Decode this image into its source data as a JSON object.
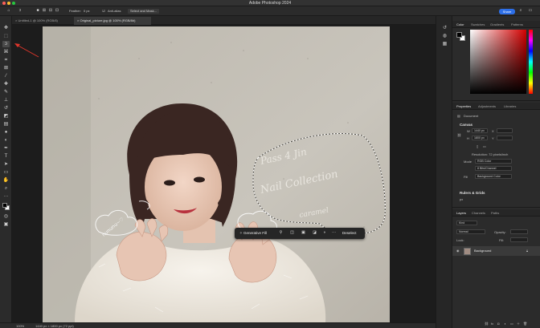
{
  "app": {
    "title": "Adobe Photoshop 2024"
  },
  "options_bar": {
    "feather_label": "Feather:",
    "feather_value": "0 px",
    "anti_alias_label": "Anti-alias",
    "select_mask_label": "Select and Mask...",
    "share_label": "Share"
  },
  "tabs": [
    {
      "label": "Untitled-1 @ 100% (RGB/8)",
      "close": "×"
    },
    {
      "label": "Original_picture.jpg @ 100% (RGB/8#)",
      "close": "×"
    }
  ],
  "taskbar": {
    "generative_fill_label": "Generative Fill",
    "deselect_label": "Deselect",
    "more_label": "···"
  },
  "photo": {
    "wall_text": [
      "Pass 4 Jin",
      "Nail Collection",
      "caramel"
    ],
    "bubble_text": "nununu~♡"
  },
  "status": {
    "zoom": "100%",
    "dimensions": "1440 px × 1800 px (72 ppi)"
  },
  "color_panel": {
    "tabs": [
      "Color",
      "Swatches",
      "Gradients",
      "Patterns"
    ],
    "foreground": "#000000",
    "background": "#ffffff",
    "hue_color": "#d40000"
  },
  "properties_panel": {
    "tabs": [
      "Properties",
      "Adjustments",
      "Libraries"
    ],
    "doc_label": "Document",
    "canvas_heading": "Canvas",
    "w_label": "W",
    "w_value": "1440 px",
    "h_label": "H",
    "h_value": "1800 px",
    "x_label": "X",
    "y_label": "Y",
    "resolution_label": "Resolution: 72 pixels/inch",
    "mode_label": "Mode",
    "mode_value": "RGB Color",
    "bits_value": "8 Bits/Channel",
    "fill_label": "Fill",
    "fill_value": "Background Color",
    "rulers_heading": "Rulers & Grids",
    "units_value": "px"
  },
  "layers_panel": {
    "tabs": [
      "Layers",
      "Channels",
      "Paths"
    ],
    "kind_placeholder": "Kind",
    "blend_value": "Normal",
    "opacity_label": "Opacity:",
    "lock_label": "Lock:",
    "fill_label": "Fill:",
    "layer_name": "Background"
  }
}
